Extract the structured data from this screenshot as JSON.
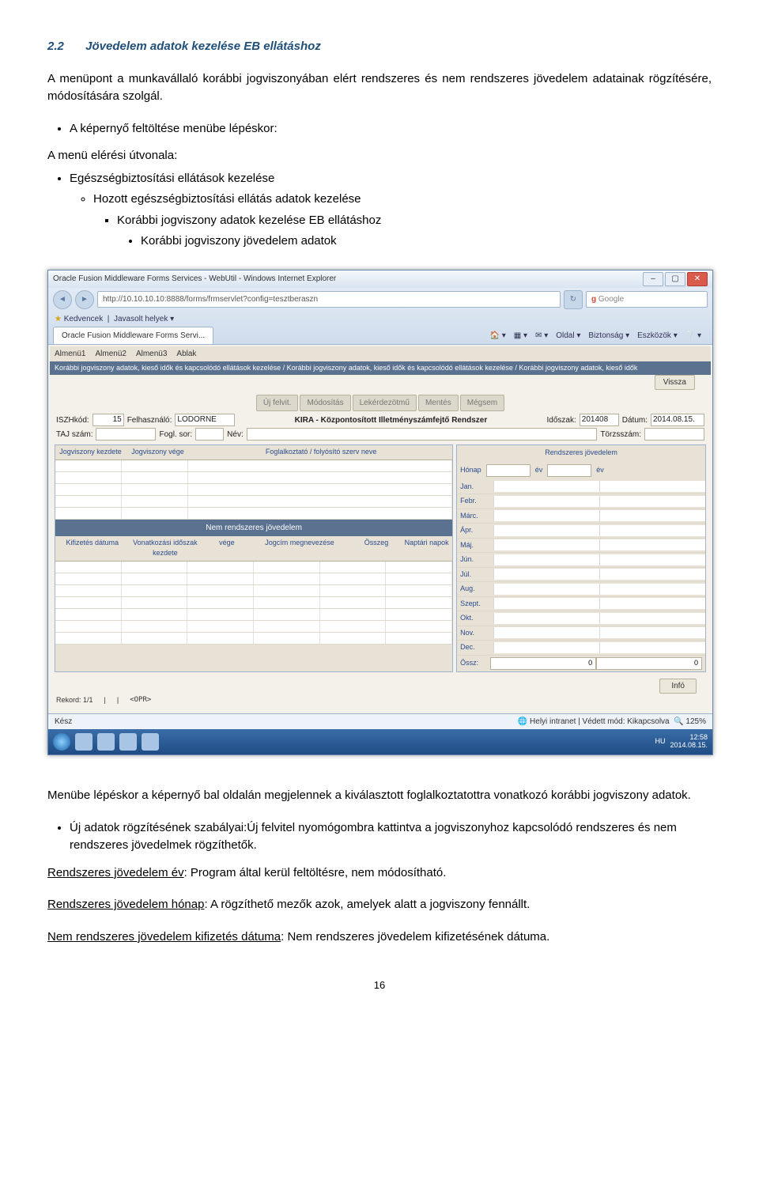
{
  "heading": {
    "number": "2.2",
    "title": "Jövedelem adatok kezelése EB ellátáshoz"
  },
  "intro": "A menüpont a munkavállaló korábbi jogviszonyában elért rendszeres és nem rendszeres jövedelem adatainak rögzítésére, módosítására szolgál.",
  "bullet_screen_load": "A képernyő feltöltése menübe lépéskor:",
  "menu_path_intro": "A menü elérési útvonala:",
  "menu_path": {
    "l1": "Egészségbiztosítási ellátások kezelése",
    "l2": "Hozott egészségbiztosítási ellátás adatok kezelése",
    "l3": "Korábbi jogviszony adatok kezelése EB ellátáshoz",
    "l4": "Korábbi jogviszony jövedelem adatok"
  },
  "after_shot": "Menübe lépéskor a képernyő bal oldalán megjelennek a kiválasztott foglalkoztatottra vonatkozó korábbi jogviszony adatok.",
  "uj_adatok_bullet": "Új adatok rögzítésének szabályai:Új felvitel nyomógombra kattintva a jogviszonyhoz kapcsolódó rendszeres és nem rendszeres jövedelmek rögzíthetők.",
  "rules": {
    "r1_label": "Rendszeres jövedelem év",
    "r1_rest": ": Program által kerül feltöltésre, nem módosítható.",
    "r2_label": "Rendszeres jövedelem hónap",
    "r2_rest": ": A rögzíthető mezők azok, amelyek alatt a jogviszony fennállt.",
    "r3_label": "Nem rendszeres jövedelem kifizetés dátuma",
    "r3_rest": ": Nem rendszeres jövedelem kifizetésének dátuma."
  },
  "page_number": "16",
  "screenshot": {
    "ie_title": "Oracle Fusion Middleware Forms Services - WebUtil - Windows Internet Explorer",
    "url": "http://10.10.10.10:8888/forms/frmservlet?config=tesztberaszn",
    "search_placeholder": "Google",
    "fav_label": "Kedvencek",
    "fav_item": "Javasolt helyek",
    "tab_label": "Oracle Fusion Middleware Forms Servi...",
    "tools": {
      "home": "Oldal",
      "safety": "Biztonság",
      "tools": "Eszközök"
    },
    "menus": [
      "Almenü1",
      "Almenü2",
      "Almenü3",
      "Ablak"
    ],
    "breadcrumb": "Korábbi jogviszony adatok, kieső idők és kapcsolódó ellátások kezelése / Korábbi jogviszony adatok, kieső idők és kapcsolódó ellátások kezelése / Korábbi jogviszony adatok, kieső idők",
    "form_buttons": [
      "Új felvit.",
      "Módosítás",
      "Lekérdezötmű",
      "Mentés",
      "Mégsem"
    ],
    "vissza": "Vissza",
    "row1": {
      "iszh_l": "ISZHkód:",
      "iszh_v": "15",
      "felh_l": "Felhasználó:",
      "felh_v": "LODORNE",
      "center": "KIRA - Központosított Illetményszámfejtő Rendszer",
      "idoszak_l": "Időszak:",
      "idoszak_v": "201408",
      "datum_l": "Dátum:",
      "datum_v": "2014.08.15."
    },
    "row2": {
      "taj_l": "TAJ szám:",
      "fogl_l": "Fogl. sor:",
      "nev_l": "Név:",
      "torzs_l": "Törzsszám:"
    },
    "left_top_headers": [
      "Jogviszony kezdete",
      "Jogviszony vége",
      "Foglalkoztató / folyósító szerv neve"
    ],
    "blue_band": "Nem rendszeres jövedelem",
    "left_bot_headers": [
      "Kifizetés dátuma",
      "Vonatkozási időszak kezdete",
      "vége",
      "Jogcím megnevezése",
      "Összeg",
      "Naptári napok"
    ],
    "right_title": "Rendszeres jövedelem",
    "right_labels": {
      "honap": "Hónap",
      "ev": "év"
    },
    "months": [
      "Jan.",
      "Febr.",
      "Márc.",
      "Ápr.",
      "Máj.",
      "Jún.",
      "Júl.",
      "Aug.",
      "Szept.",
      "Okt.",
      "Nov.",
      "Dec."
    ],
    "sum_label": "Össz:",
    "sum_v1": "0",
    "sum_v2": "0",
    "info_btn": "Infó",
    "record": "Rekord: 1/1",
    "opr": "<OPR>",
    "ie_status_left": "Kész",
    "ie_status_right": "Helyi intranet | Védett mód: Kikapcsolva",
    "zoom": "125%",
    "clock_time": "12:58",
    "clock_date": "2014.08.15.",
    "lang": "HU"
  }
}
